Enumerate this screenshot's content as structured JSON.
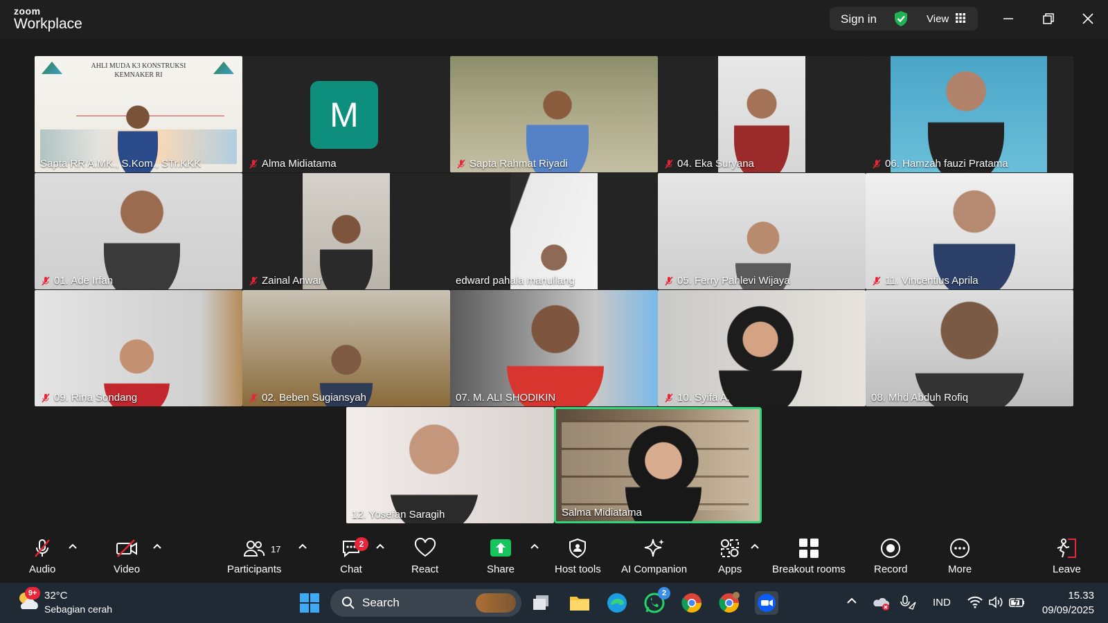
{
  "titlebar": {
    "logo_small": "zoom",
    "logo_big": "Workplace",
    "signin_label": "Sign in",
    "view_label": "View"
  },
  "participants": [
    {
      "name": "Sapta RR A.MK., S.Kom., STr.KKK",
      "muted": false,
      "slide_title_1": "AHLI MUDA K3 KONSTRUKSI",
      "slide_title_2": "KEMNAKER RI"
    },
    {
      "name": "Alma Midiatama",
      "muted": true,
      "avatar_letter": "M"
    },
    {
      "name": "Sapta Rahmat Riyadi",
      "muted": true
    },
    {
      "name": "04. Eka Suryana",
      "muted": true
    },
    {
      "name": "06. Hamzah fauzi Pratama",
      "muted": true
    },
    {
      "name": "01. Ade Irfan",
      "muted": true
    },
    {
      "name": "Zainal Anwar",
      "muted": true
    },
    {
      "name": "edward pahala manullang",
      "muted": false
    },
    {
      "name": "05. Ferry Pahlevi Wijaya",
      "muted": true
    },
    {
      "name": "11. Vincentius Aprila",
      "muted": true
    },
    {
      "name": "09. Rina Sondang",
      "muted": true
    },
    {
      "name": "02. Beben Sugiansyah",
      "muted": true
    },
    {
      "name": "07. M. ALI SHODIKIN",
      "muted": false
    },
    {
      "name": "10. Syifa A.",
      "muted": true
    },
    {
      "name": "08. Mhd Abduh Rofiq",
      "muted": false
    },
    {
      "name": "12. Yosefan Saragih",
      "muted": false
    },
    {
      "name": "Salma Midiatama",
      "muted": false,
      "active_speaker": true
    }
  ],
  "toolbar": {
    "audio": "Audio",
    "video": "Video",
    "participants": "Participants",
    "participants_count": "17",
    "chat": "Chat",
    "chat_badge": "2",
    "react": "React",
    "share": "Share",
    "host_tools": "Host tools",
    "ai_companion": "AI Companion",
    "apps": "Apps",
    "breakout_rooms": "Breakout rooms",
    "record": "Record",
    "more": "More",
    "leave": "Leave"
  },
  "taskbar": {
    "weather_badge": "9+",
    "temperature": "32°C",
    "condition": "Sebagian cerah",
    "search_label": "Search",
    "whatsapp_badge": "2",
    "language": "IND",
    "time": "15.33",
    "date": "09/09/2025"
  },
  "colors": {
    "accent_green": "#2fd67a",
    "mute_red": "#e8263a",
    "share_green": "#18c45c",
    "zoom_blue": "#0b5cff"
  }
}
